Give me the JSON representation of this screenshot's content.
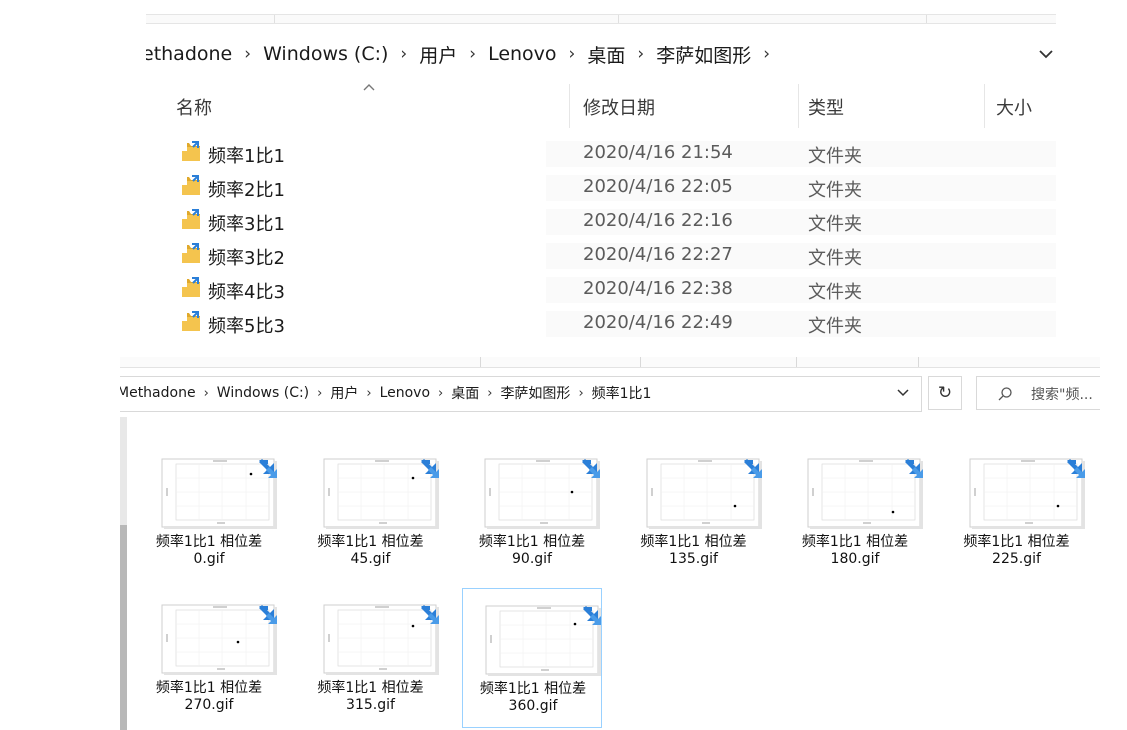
{
  "top_window": {
    "breadcrumb": [
      "ethadone",
      "Windows (C:)",
      "用户",
      "Lenovo",
      "桌面",
      "李萨如图形"
    ],
    "breadcrumb_separator": "›",
    "columns": {
      "name": "名称",
      "date_modified": "修改日期",
      "type": "类型",
      "size": "大小"
    },
    "sort_indicator": "^",
    "rows": [
      {
        "name": "频率1比1",
        "date": "2020/4/16 21:54",
        "type": "文件夹"
      },
      {
        "name": "频率2比1",
        "date": "2020/4/16 22:05",
        "type": "文件夹"
      },
      {
        "name": "频率3比1",
        "date": "2020/4/16 22:16",
        "type": "文件夹"
      },
      {
        "name": "频率3比2",
        "date": "2020/4/16 22:27",
        "type": "文件夹"
      },
      {
        "name": "频率4比3",
        "date": "2020/4/16 22:38",
        "type": "文件夹"
      },
      {
        "name": "频率5比3",
        "date": "2020/4/16 22:49",
        "type": "文件夹"
      }
    ]
  },
  "bottom_window": {
    "breadcrumb": [
      "Methadone",
      "Windows (C:)",
      "用户",
      "Lenovo",
      "桌面",
      "李萨如图形",
      "频率1比1"
    ],
    "breadcrumb_separator": "›",
    "refresh_glyph": "↻",
    "search_placeholder": "搜索\"频...",
    "files": [
      {
        "label_line1": "频率1比1 相位差",
        "label_line2": "0.gif"
      },
      {
        "label_line1": "频率1比1 相位差",
        "label_line2": "45.gif"
      },
      {
        "label_line1": "频率1比1 相位差",
        "label_line2": "90.gif"
      },
      {
        "label_line1": "频率1比1 相位差",
        "label_line2": "135.gif"
      },
      {
        "label_line1": "频率1比1 相位差",
        "label_line2": "180.gif"
      },
      {
        "label_line1": "频率1比1 相位差",
        "label_line2": "225.gif"
      },
      {
        "label_line1": "频率1比1 相位差",
        "label_line2": "270.gif"
      },
      {
        "label_line1": "频率1比1 相位差",
        "label_line2": "315.gif"
      },
      {
        "label_line1": "频率1比1 相位差",
        "label_line2": "360.gif",
        "selected": true
      }
    ]
  },
  "colors": {
    "folder": "#f4c44e",
    "folder_dark": "#e0a92b",
    "shortcut_badge": "#2b7fd8",
    "selection_border": "#99d1ff",
    "plot_dot": "#000000"
  },
  "icons": {
    "folder": "folder-icon",
    "shortcut": "shortcut-arrow-icon",
    "chevron": "chevron-down-icon",
    "refresh": "refresh-icon",
    "search": "search-icon"
  }
}
